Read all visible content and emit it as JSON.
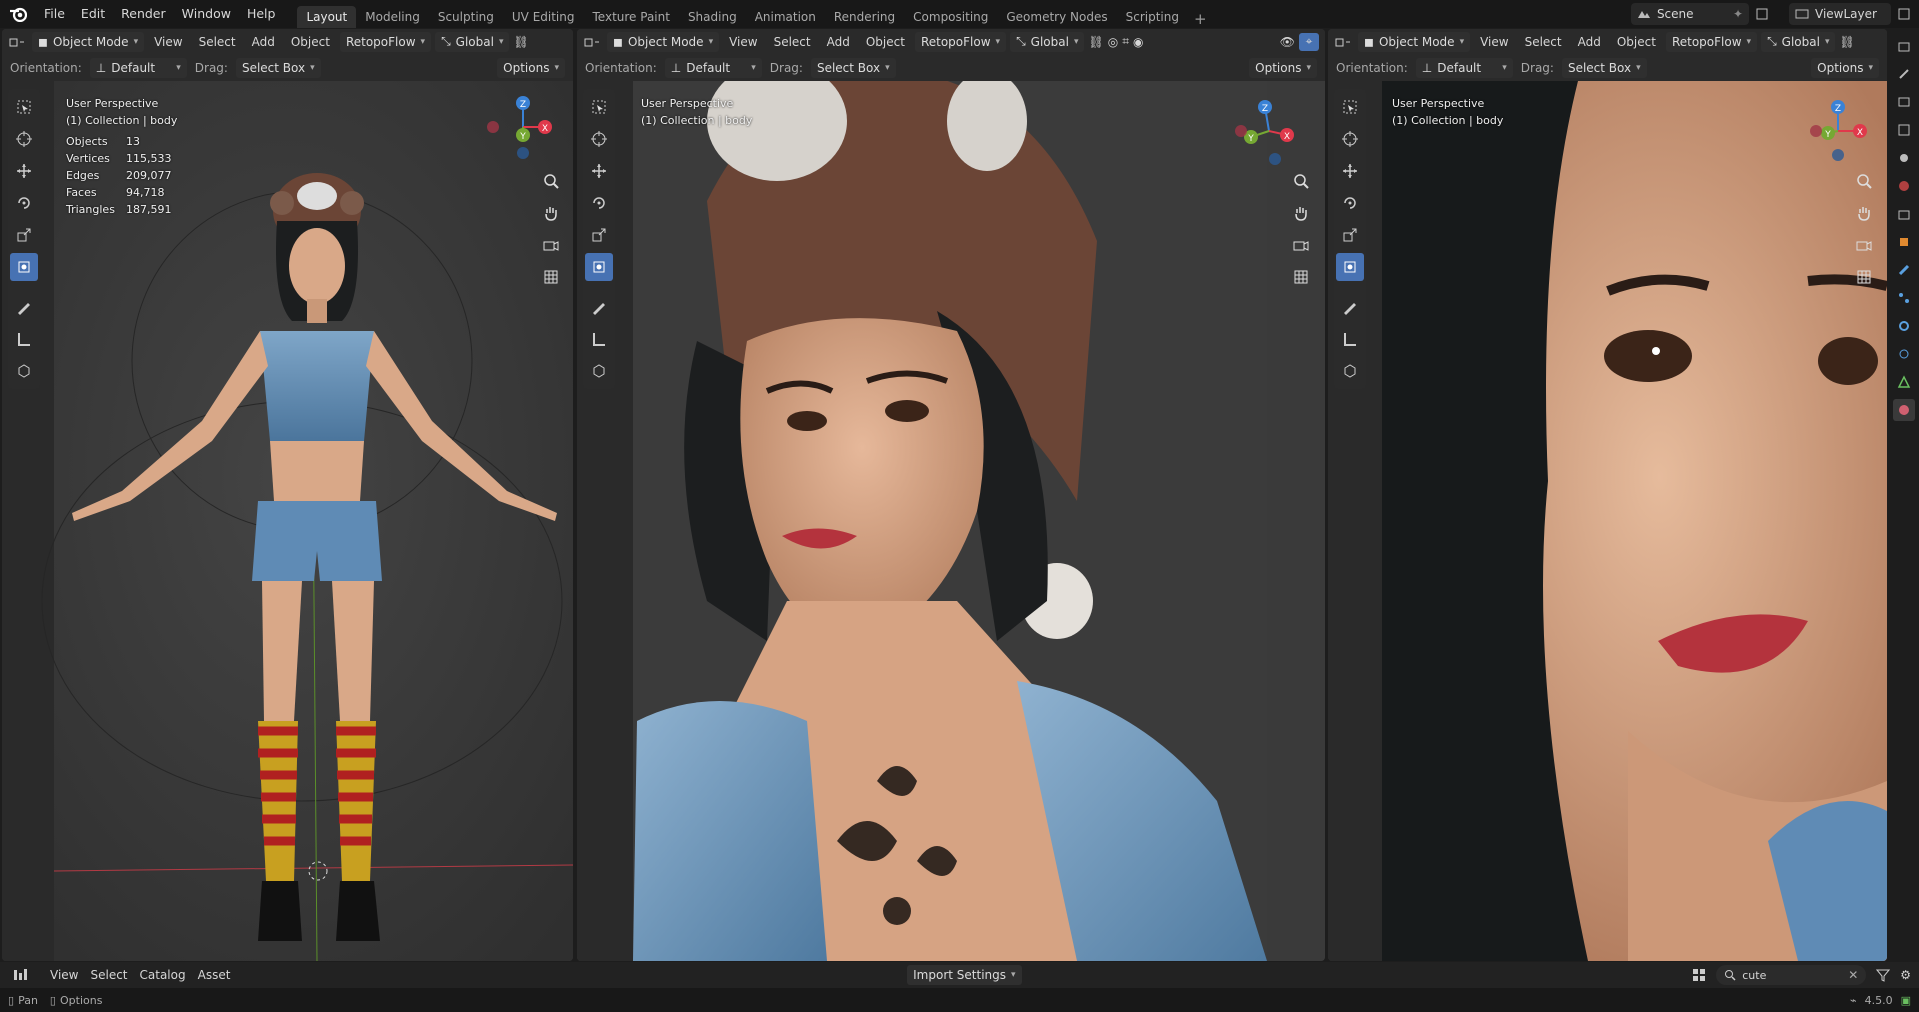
{
  "topbar": {
    "menus": [
      "File",
      "Edit",
      "Render",
      "Window",
      "Help"
    ],
    "workspaces": [
      "Layout",
      "Modeling",
      "Sculpting",
      "UV Editing",
      "Texture Paint",
      "Shading",
      "Animation",
      "Rendering",
      "Compositing",
      "Geometry Nodes",
      "Scripting"
    ],
    "active_workspace": "Layout",
    "add_tab": "+",
    "scene": "Scene",
    "view_layer": "ViewLayer"
  },
  "viewports": [
    {
      "mode": "Object Mode",
      "menus": [
        "View",
        "Select",
        "Add",
        "Object"
      ],
      "retopo": "RetopoFlow",
      "transform": "Global",
      "orientation_label": "Orientation:",
      "orientation_value": "Default",
      "drag_label": "Drag:",
      "drag_value": "Select Box",
      "options": "Options",
      "perspective": "User Perspective",
      "collection": "(1) Collection | body",
      "stats": [
        {
          "label": "Objects",
          "value": "13"
        },
        {
          "label": "Vertices",
          "value": "115,533"
        },
        {
          "label": "Edges",
          "value": "209,077"
        },
        {
          "label": "Faces",
          "value": "94,718"
        },
        {
          "label": "Triangles",
          "value": "187,591"
        }
      ]
    },
    {
      "mode": "Object Mode",
      "menus": [
        "View",
        "Select",
        "Add",
        "Object"
      ],
      "retopo": "RetopoFlow",
      "transform": "Global",
      "orientation_label": "Orientation:",
      "orientation_value": "Default",
      "drag_label": "Drag:",
      "drag_value": "Select Box",
      "options": "Options",
      "perspective": "User Perspective",
      "collection": "(1) Collection | body"
    },
    {
      "mode": "Object Mode",
      "menus": [
        "View",
        "Select",
        "Add",
        "Object"
      ],
      "retopo": "RetopoFlow",
      "transform": "Global",
      "orientation_label": "Orientation:",
      "orientation_value": "Default",
      "drag_label": "Drag:",
      "drag_value": "Select Box",
      "options": "Options",
      "perspective": "User Perspective",
      "collection": "(1) Collection | body"
    }
  ],
  "gizmo_axes": {
    "x": "X",
    "y": "Y",
    "z": "Z"
  },
  "colors": {
    "accent": "#4772b3",
    "x_axis": "#e0394b",
    "y_axis": "#76a833",
    "z_axis": "#3a82d6",
    "skin": "#d9a888",
    "hat": "#6b4536",
    "denim": "#5f8bb5",
    "hair": "#1c1e1f"
  },
  "asset_browser": {
    "menus": [
      "View",
      "Select",
      "Catalog",
      "Asset"
    ],
    "import_settings": "Import Settings",
    "search_value": "cute"
  },
  "status": {
    "pan": "Pan",
    "options": "Options",
    "version": "4.5.0"
  }
}
